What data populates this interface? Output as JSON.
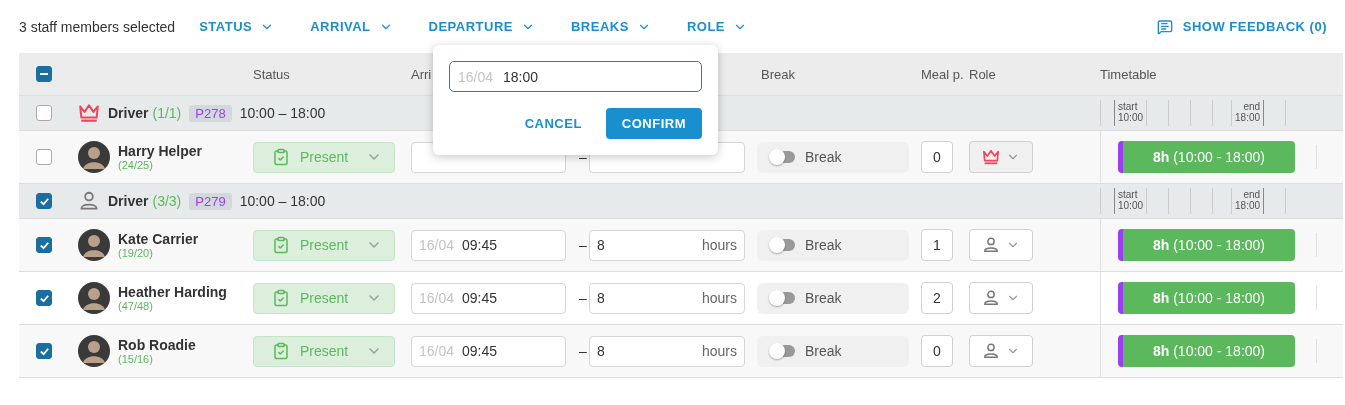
{
  "toolbar": {
    "selection": "3 staff members selected",
    "filters": [
      {
        "label": "STATUS"
      },
      {
        "label": "ARRIVAL"
      },
      {
        "label": "DEPARTURE"
      },
      {
        "label": "BREAKS"
      },
      {
        "label": "ROLE"
      }
    ],
    "feedback": "SHOW FEEDBACK (0)"
  },
  "header": {
    "checkbox_partial": true,
    "status": "Status",
    "arrival": "Arri",
    "break": "Break",
    "meal": "Meal p.",
    "role": "Role",
    "timetable": "Timetable"
  },
  "groups": [
    {
      "lead": true,
      "title": "Driver",
      "count": "(1/1)",
      "code": "P278",
      "time": "10:00 – 18:00",
      "checked": false,
      "timetable": {
        "start_label": "start",
        "start_time": "10:00",
        "end_label": "end",
        "end_time": "18:00"
      },
      "members": [
        {
          "name": "Harry Helper",
          "count": "(24/25)",
          "checked": false,
          "status": "Present",
          "separator": "–",
          "break_label": "Break",
          "break_on": false,
          "meal": "0",
          "lead": true,
          "shift": "**8h** (10:00 - 18:00)"
        }
      ]
    },
    {
      "lead": false,
      "title": "Driver",
      "count": "(3/3)",
      "code": "P279",
      "time": "10:00 – 18:00",
      "checked": true,
      "timetable": {
        "start_label": "start",
        "start_time": "10:00",
        "end_label": "end",
        "end_time": "18:00"
      },
      "members": [
        {
          "name": "Kate Carrier",
          "count": "(19/20)",
          "checked": true,
          "status": "Present",
          "arrival_date": "16/04",
          "arrival_time": "09:45",
          "separator": "–",
          "duration": "8",
          "duration_unit": "hours",
          "break_label": "Break",
          "break_on": false,
          "meal": "1",
          "lead": false,
          "shift": "**8h** (10:00 - 18:00)"
        },
        {
          "name": "Heather Harding",
          "count": "(47/48)",
          "checked": true,
          "status": "Present",
          "arrival_date": "16/04",
          "arrival_time": "09:45",
          "separator": "–",
          "duration": "8",
          "duration_unit": "hours",
          "break_label": "Break",
          "break_on": false,
          "meal": "2",
          "lead": false,
          "shift": "**8h** (10:00 - 18:00)"
        },
        {
          "name": "Rob Roadie",
          "count": "(15/16)",
          "checked": true,
          "status": "Present",
          "arrival_date": "16/04",
          "arrival_time": "09:45",
          "separator": "–",
          "duration": "8",
          "duration_unit": "hours",
          "break_label": "Break",
          "break_on": false,
          "meal": "0",
          "lead": false,
          "shift": "**8h** (10:00 - 18:00)"
        }
      ]
    }
  ],
  "popup": {
    "date": "16/04",
    "value": "18:00",
    "cancel": "CANCEL",
    "confirm": "CONFIRM"
  }
}
